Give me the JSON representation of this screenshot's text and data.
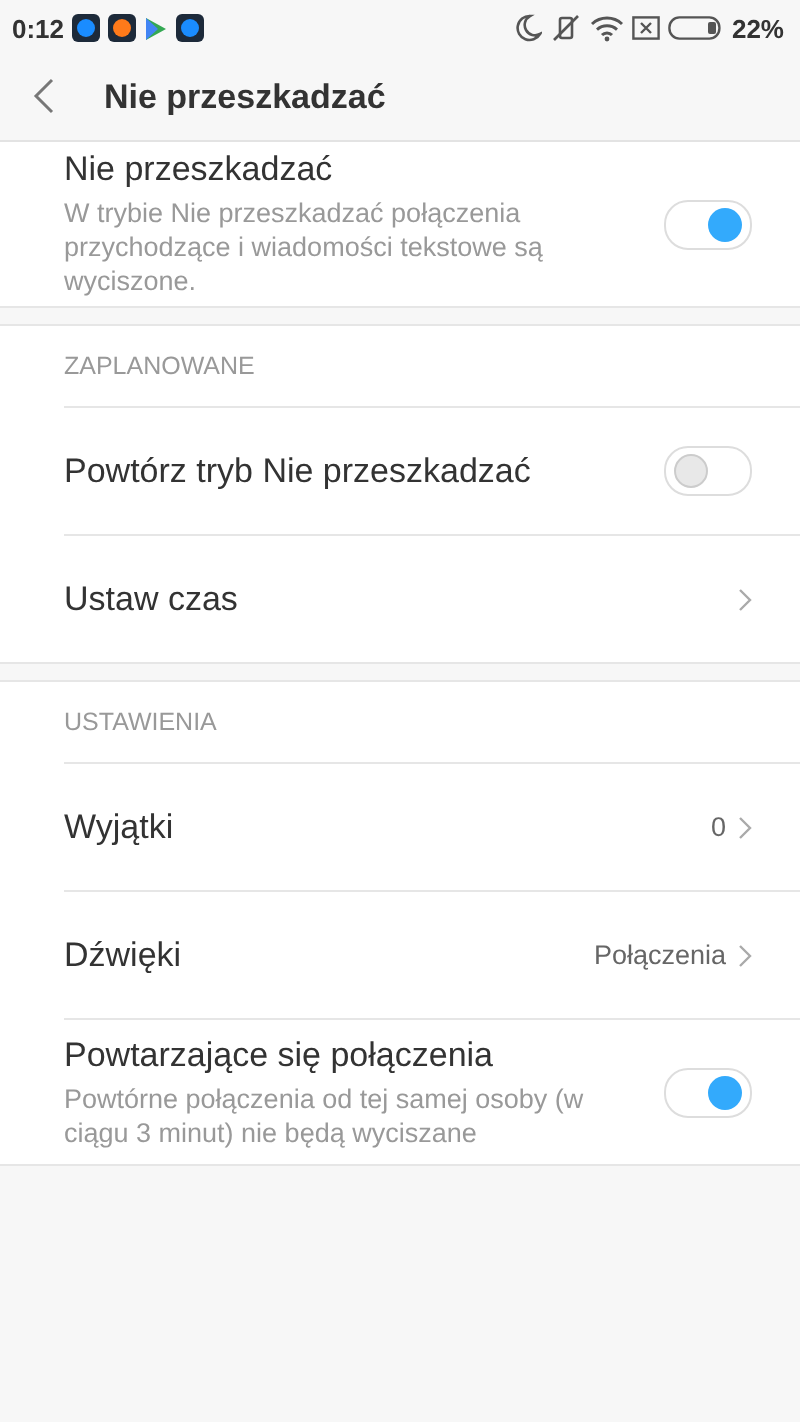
{
  "status_bar": {
    "time": "0:12",
    "battery": "22%"
  },
  "header": {
    "title": "Nie przeszkadzać"
  },
  "sections": [
    {
      "items": [
        {
          "kind": "toggle",
          "label": "Nie przeszkadzać",
          "description": "W trybie Nie przeszkadzać połączenia przychodzące i wiadomości tekstowe są wyciszone.",
          "on": true
        }
      ]
    },
    {
      "header": "ZAPLANOWANE",
      "items": [
        {
          "kind": "toggle",
          "label": "Powtórz tryb Nie przeszkadzać",
          "on": false
        },
        {
          "kind": "link",
          "label": "Ustaw czas"
        }
      ]
    },
    {
      "header": "USTAWIENIA",
      "items": [
        {
          "kind": "link",
          "label": "Wyjątki",
          "value": "0"
        },
        {
          "kind": "link",
          "label": "Dźwięki",
          "value": "Połączenia"
        },
        {
          "kind": "toggle",
          "label": "Powtarzające się połączenia",
          "description": "Powtórne połączenia od tej samej osoby (w ciągu 3 minut) nie będą wyciszane",
          "on": true
        }
      ]
    }
  ]
}
